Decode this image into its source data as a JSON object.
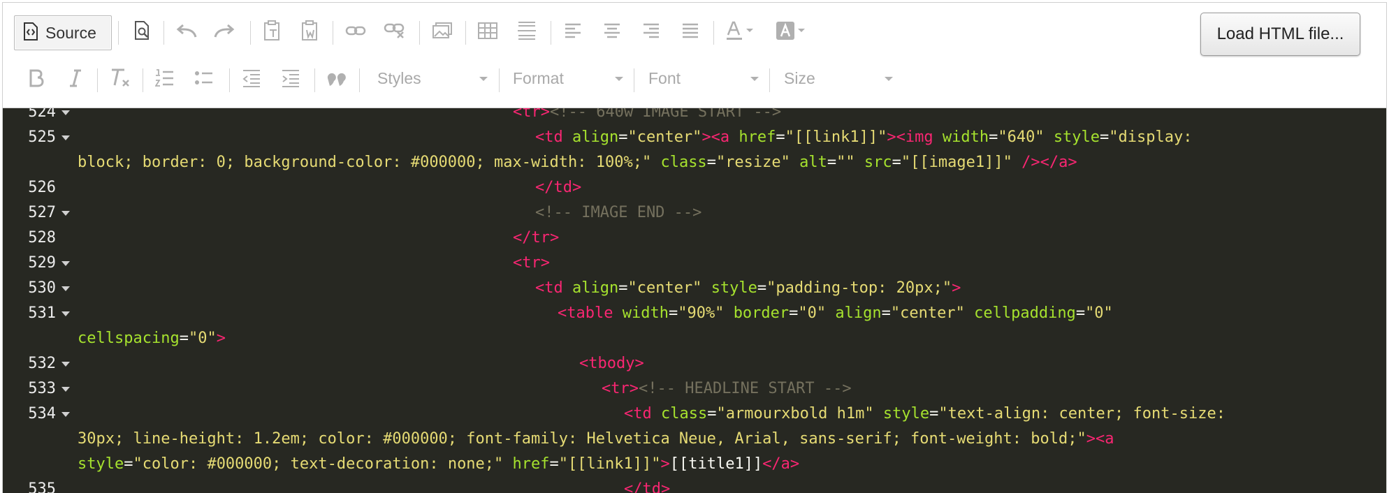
{
  "toolbar": {
    "source_label": "Source",
    "load_button_label": "Load HTML file...",
    "row1_icons": [
      "source-icon",
      "preview-icon",
      "undo-icon",
      "redo-icon",
      "paste-text-icon",
      "paste-word-icon",
      "link-icon",
      "unlink-icon",
      "image-icon",
      "table-icon",
      "horizontal-line-icon",
      "align-left-icon",
      "align-center-icon",
      "align-right-icon",
      "justify-icon",
      "text-color-icon",
      "background-color-icon"
    ],
    "row2_icons": [
      "bold-icon",
      "italic-icon",
      "remove-format-icon",
      "numbered-list-icon",
      "bulleted-list-icon",
      "outdent-icon",
      "indent-icon",
      "blockquote-icon"
    ],
    "combos": {
      "styles": "Styles",
      "format": "Format",
      "font": "Font",
      "size": "Size"
    }
  },
  "editor": {
    "theme_colors": {
      "background": "#272822",
      "tag": "#f92672",
      "attribute": "#a6e22e",
      "string": "#e6db74",
      "comment": "#75715e",
      "plain": "#f8f8f2"
    },
    "lines": [
      {
        "num": "524",
        "fold": true
      },
      {
        "num": "525",
        "fold": true
      },
      {
        "num": "",
        "fold": false
      },
      {
        "num": "526",
        "fold": false
      },
      {
        "num": "527",
        "fold": true
      },
      {
        "num": "528",
        "fold": false
      },
      {
        "num": "529",
        "fold": true
      },
      {
        "num": "530",
        "fold": true
      },
      {
        "num": "531",
        "fold": true
      },
      {
        "num": "",
        "fold": false
      },
      {
        "num": "532",
        "fold": true
      },
      {
        "num": "533",
        "fold": true
      },
      {
        "num": "534",
        "fold": true
      },
      {
        "num": "",
        "fold": false
      },
      {
        "num": "",
        "fold": false
      },
      {
        "num": "535",
        "fold": false
      }
    ],
    "code": {
      "l524": [
        [
          "t",
          "<tr>"
        ],
        [
          "c",
          "<!-- 640w IMAGE START -->"
        ]
      ],
      "l525": [
        [
          "t",
          "<td "
        ],
        [
          "a",
          "align"
        ],
        [
          "p",
          "="
        ],
        [
          "s",
          "\"center\""
        ],
        [
          "t",
          "><a "
        ],
        [
          "a",
          "href"
        ],
        [
          "p",
          "="
        ],
        [
          "s",
          "\"[[link1]]\""
        ],
        [
          "t",
          "><img "
        ],
        [
          "a",
          "width"
        ],
        [
          "p",
          "="
        ],
        [
          "s",
          "\"640\" "
        ],
        [
          "a",
          "style"
        ],
        [
          "p",
          "="
        ],
        [
          "s",
          "\"display:"
        ]
      ],
      "l525b": [
        [
          "s",
          "block; border: 0; background-color: #000000; max-width: 100%;\" "
        ],
        [
          "a",
          "class"
        ],
        [
          "p",
          "="
        ],
        [
          "s",
          "\"resize\" "
        ],
        [
          "a",
          "alt"
        ],
        [
          "p",
          "="
        ],
        [
          "s",
          "\"\" "
        ],
        [
          "a",
          "src"
        ],
        [
          "p",
          "="
        ],
        [
          "s",
          "\"[[image1]]\" "
        ],
        [
          "t",
          "/></a>"
        ]
      ],
      "l526": [
        [
          "t",
          "</td>"
        ]
      ],
      "l527": [
        [
          "c",
          "<!-- IMAGE END -->"
        ]
      ],
      "l528": [
        [
          "t",
          "</tr>"
        ]
      ],
      "l529": [
        [
          "t",
          "<tr>"
        ]
      ],
      "l530": [
        [
          "t",
          "<td "
        ],
        [
          "a",
          "align"
        ],
        [
          "p",
          "="
        ],
        [
          "s",
          "\"center\" "
        ],
        [
          "a",
          "style"
        ],
        [
          "p",
          "="
        ],
        [
          "s",
          "\"padding-top: 20px;\""
        ],
        [
          "t",
          ">"
        ]
      ],
      "l531": [
        [
          "t",
          "<table "
        ],
        [
          "a",
          "width"
        ],
        [
          "p",
          "="
        ],
        [
          "s",
          "\"90%\" "
        ],
        [
          "a",
          "border"
        ],
        [
          "p",
          "="
        ],
        [
          "s",
          "\"0\" "
        ],
        [
          "a",
          "align"
        ],
        [
          "p",
          "="
        ],
        [
          "s",
          "\"center\" "
        ],
        [
          "a",
          "cellpadding"
        ],
        [
          "p",
          "="
        ],
        [
          "s",
          "\"0\""
        ]
      ],
      "l531b": [
        [
          "a",
          "cellspacing"
        ],
        [
          "p",
          "="
        ],
        [
          "s",
          "\"0\""
        ],
        [
          "t",
          ">"
        ]
      ],
      "l532": [
        [
          "t",
          "<tbody>"
        ]
      ],
      "l533": [
        [
          "t",
          "<tr>"
        ],
        [
          "c",
          "<!-- HEADLINE START -->"
        ]
      ],
      "l534": [
        [
          "t",
          "<td "
        ],
        [
          "a",
          "class"
        ],
        [
          "p",
          "="
        ],
        [
          "s",
          "\"armourxbold h1m\" "
        ],
        [
          "a",
          "style"
        ],
        [
          "p",
          "="
        ],
        [
          "s",
          "\"text-align: center; font-size:"
        ]
      ],
      "l534b": [
        [
          "s",
          "30px; line-height: 1.2em; color: #000000; font-family: Helvetica Neue, Arial, sans-serif; font-weight: bold;\""
        ],
        [
          "t",
          "><a"
        ]
      ],
      "l534c": [
        [
          "a",
          "style"
        ],
        [
          "p",
          "="
        ],
        [
          "s",
          "\"color: #000000; text-decoration: none;\" "
        ],
        [
          "a",
          "href"
        ],
        [
          "p",
          "="
        ],
        [
          "s",
          "\"[[link1]]\""
        ],
        [
          "t",
          ">"
        ],
        [
          "p",
          "[[title1]]"
        ],
        [
          "t",
          "</a>"
        ]
      ],
      "l535": [
        [
          "t",
          "</td>"
        ]
      ]
    }
  }
}
